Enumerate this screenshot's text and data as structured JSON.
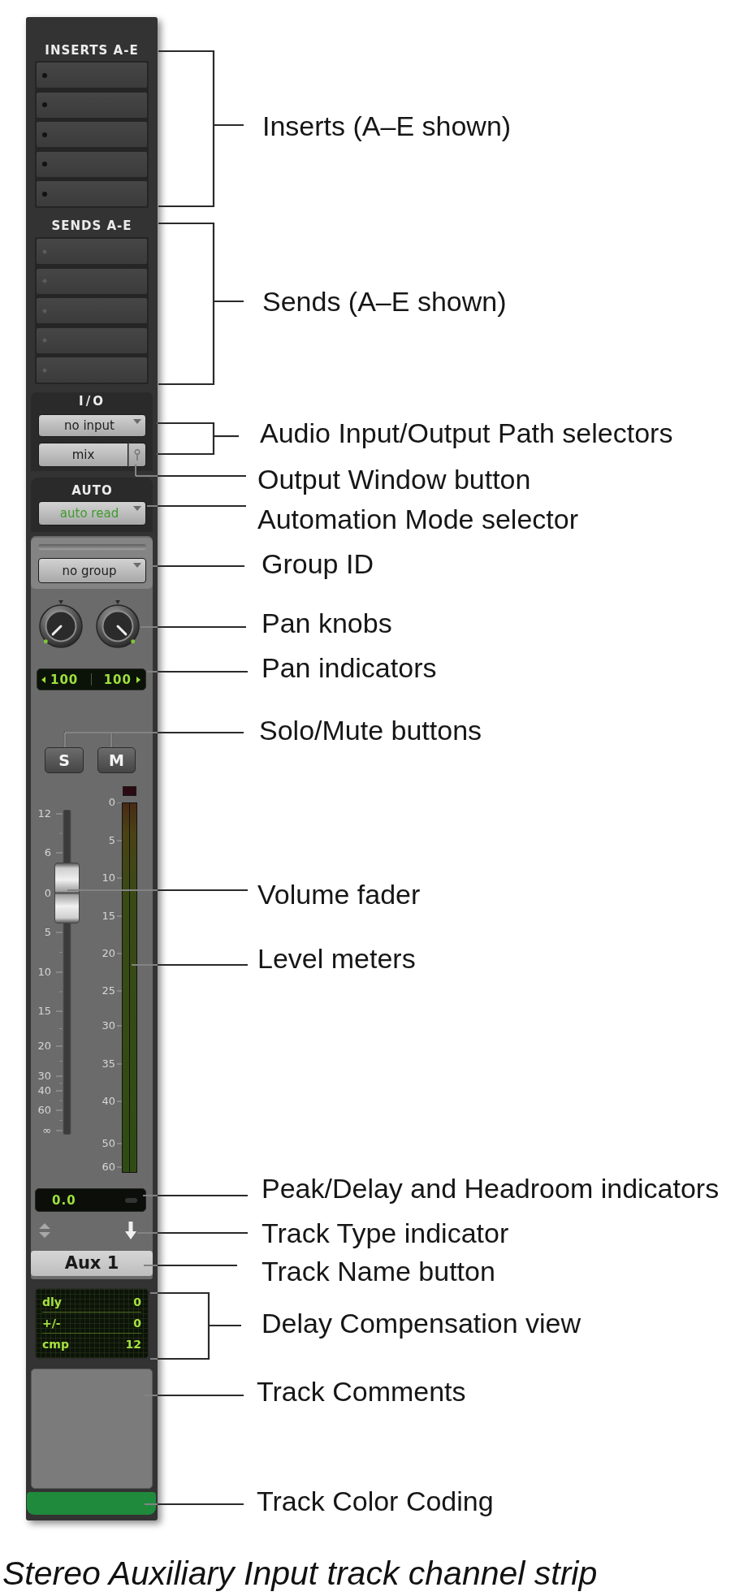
{
  "channel_strip": {
    "inserts": {
      "header": "INSERTS A-E",
      "slots": [
        {
          "kind": "empty"
        },
        {
          "kind": "empty"
        },
        {
          "kind": "empty"
        },
        {
          "kind": "empty"
        },
        {
          "kind": "empty"
        }
      ]
    },
    "sends": {
      "header": "SENDS A-E",
      "slots": [
        {
          "kind": "empty"
        },
        {
          "kind": "empty"
        },
        {
          "kind": "empty"
        },
        {
          "kind": "empty"
        },
        {
          "kind": "empty"
        }
      ]
    },
    "io": {
      "label": "I/O",
      "input": "no input",
      "output": "mix"
    },
    "automation": {
      "label": "AUTO",
      "mode": "auto read"
    },
    "group": {
      "value": "no group"
    },
    "pan": {
      "knobs": [
        {
          "kind": "left"
        },
        {
          "kind": "right"
        }
      ],
      "readings": [
        "100",
        "100"
      ]
    },
    "solo": {
      "label": "S",
      "on": false
    },
    "mute": {
      "label": "M",
      "on": false
    },
    "fader": {
      "scale": [
        "12",
        "6",
        "0",
        "5",
        "10",
        "15",
        "20",
        "30",
        "40",
        "60",
        "∞"
      ],
      "level": 0.75
    },
    "meter": {
      "scale": [
        "0",
        "5",
        "10",
        "15",
        "20",
        "25",
        "30",
        "35",
        "40",
        "50",
        "60"
      ],
      "clip": false
    },
    "peak": {
      "value": "0.0"
    },
    "track_name": "Aux 1",
    "delay_compensation": [
      {
        "label": "dly",
        "value": "0"
      },
      {
        "label": "+/-",
        "value": "0"
      },
      {
        "label": "cmp",
        "value": "12"
      }
    ],
    "color": "#1f8a3c"
  },
  "callouts": [
    "Inserts (A–E shown)",
    "Sends (A–E shown)",
    "Audio Input/Output Path selectors",
    "Output Window button",
    "Automation Mode selector",
    "Group ID",
    "Pan knobs",
    "Pan indicators",
    "Solo/Mute buttons",
    "Volume fader",
    "Level meters",
    "Peak/Delay and Headroom indicators",
    "Track Type indicator",
    "Track Name button",
    "Delay Compensation view",
    "Track Comments",
    "Track Color Coding"
  ],
  "caption": "Stereo Auxiliary Input track channel strip"
}
